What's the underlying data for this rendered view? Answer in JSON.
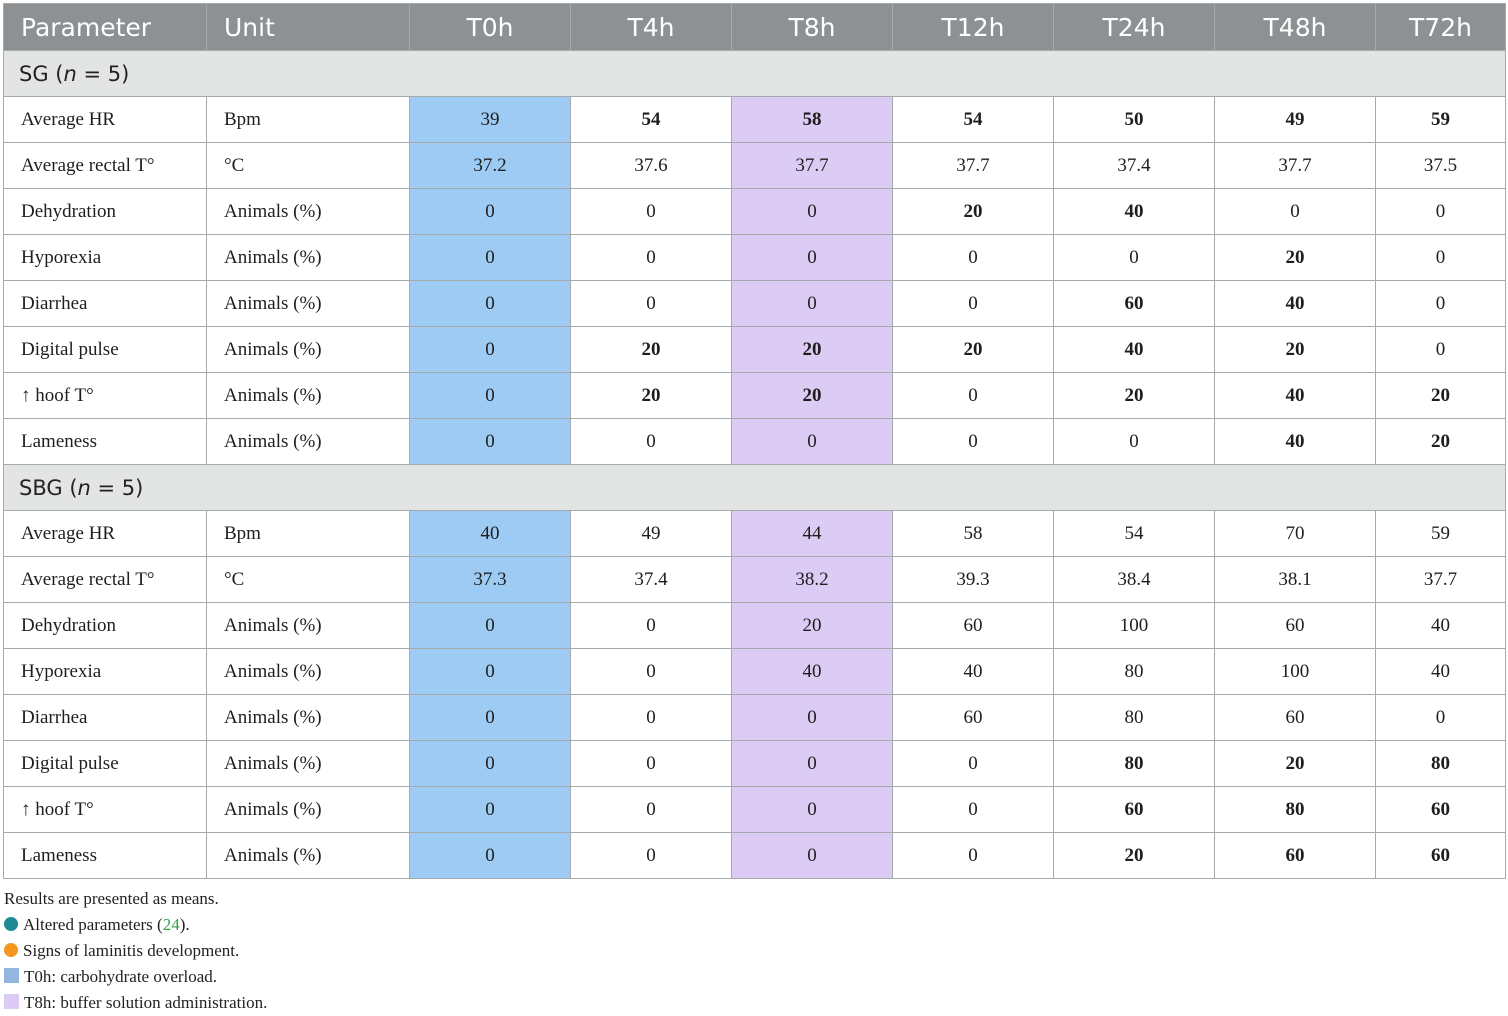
{
  "headers": [
    "Parameter",
    "Unit",
    "T0h",
    "T4h",
    "T8h",
    "T12h",
    "T24h",
    "T48h",
    "T72h"
  ],
  "groups": [
    {
      "label_prefix": "SG (",
      "label_n": "n",
      "label_suffix": " = 5)",
      "rows": [
        {
          "param": "Average HR",
          "unit": "Bpm",
          "values": [
            "39",
            "54",
            "58",
            "54",
            "50",
            "49",
            "59"
          ],
          "styles": [
            "n",
            "bt",
            "bt",
            "bt",
            "bt",
            "bt",
            "bt"
          ]
        },
        {
          "param": "Average rectal T°",
          "unit": "°C",
          "values": [
            "37.2",
            "37.6",
            "37.7",
            "37.7",
            "37.4",
            "37.7",
            "37.5"
          ],
          "styles": [
            "n",
            "n",
            "n",
            "n",
            "n",
            "n",
            "n"
          ]
        },
        {
          "param": "Dehydration",
          "unit": "Animals (%)",
          "values": [
            "0",
            "0",
            "0",
            "20",
            "40",
            "0",
            "0"
          ],
          "styles": [
            "n",
            "n",
            "n",
            "bt",
            "bt",
            "n",
            "n"
          ]
        },
        {
          "param": "Hyporexia",
          "unit": "Animals (%)",
          "values": [
            "0",
            "0",
            "0",
            "0",
            "0",
            "20",
            "0"
          ],
          "styles": [
            "n",
            "n",
            "n",
            "n",
            "n",
            "bt",
            "n"
          ]
        },
        {
          "param": "Diarrhea",
          "unit": "Animals (%)",
          "values": [
            "0",
            "0",
            "0",
            "0",
            "60",
            "40",
            "0"
          ],
          "styles": [
            "n",
            "n",
            "n",
            "n",
            "bt",
            "bt",
            "n"
          ]
        },
        {
          "param": "Digital pulse",
          "unit": "Animals (%)",
          "values": [
            "0",
            "20",
            "20",
            "20",
            "40",
            "20",
            "0"
          ],
          "styles": [
            "n",
            "o",
            "o",
            "o",
            "o",
            "o",
            "n"
          ]
        },
        {
          "param": "↑ hoof T°",
          "unit": "Animals (%)",
          "values": [
            "0",
            "20",
            "20",
            "0",
            "20",
            "40",
            "20"
          ],
          "styles": [
            "n",
            "o",
            "o",
            "n",
            "o",
            "o",
            "o"
          ]
        },
        {
          "param": "Lameness",
          "unit": "Animals (%)",
          "values": [
            "0",
            "0",
            "0",
            "0",
            "0",
            "40",
            "20"
          ],
          "styles": [
            "n",
            "n",
            "n",
            "n",
            "n",
            "o",
            "o"
          ]
        }
      ]
    },
    {
      "label_prefix": "SBG (",
      "label_n": "n",
      "label_suffix": " = 5)",
      "rows": [
        {
          "param": "Average HR",
          "unit": "Bpm",
          "values": [
            "40",
            "49",
            "44",
            "58",
            "54",
            "70",
            "59"
          ],
          "styles": [
            "n",
            "t",
            "t",
            "t",
            "t",
            "t",
            "t"
          ]
        },
        {
          "param": "Average rectal T°",
          "unit": "°C",
          "values": [
            "37.3",
            "37.4",
            "38.2",
            "39.3",
            "38.4",
            "38.1",
            "37.7"
          ],
          "styles": [
            "n",
            "n",
            "n",
            "t",
            "n",
            "n",
            "n"
          ]
        },
        {
          "param": "Dehydration",
          "unit": "Animals (%)",
          "values": [
            "0",
            "0",
            "20",
            "60",
            "100",
            "60",
            "40"
          ],
          "styles": [
            "n",
            "n",
            "t",
            "t",
            "t",
            "t",
            "t"
          ]
        },
        {
          "param": "Hyporexia",
          "unit": "Animals (%)",
          "values": [
            "0",
            "0",
            "40",
            "40",
            "80",
            "100",
            "40"
          ],
          "styles": [
            "n",
            "n",
            "t",
            "t",
            "t",
            "t",
            "t"
          ]
        },
        {
          "param": "Diarrhea",
          "unit": "Animals (%)",
          "values": [
            "0",
            "0",
            "0",
            "60",
            "80",
            "60",
            "0"
          ],
          "styles": [
            "n",
            "n",
            "n",
            "t",
            "t",
            "t",
            "n"
          ]
        },
        {
          "param": "Digital pulse",
          "unit": "Animals (%)",
          "values": [
            "0",
            "0",
            "0",
            "0",
            "80",
            "20",
            "80"
          ],
          "styles": [
            "n",
            "n",
            "n",
            "n",
            "o",
            "o",
            "o"
          ]
        },
        {
          "param": "↑ hoof T°",
          "unit": "Animals (%)",
          "values": [
            "0",
            "0",
            "0",
            "0",
            "60",
            "80",
            "60"
          ],
          "styles": [
            "n",
            "n",
            "n",
            "n",
            "o",
            "o",
            "o"
          ]
        },
        {
          "param": "Lameness",
          "unit": "Animals (%)",
          "values": [
            "0",
            "0",
            "0",
            "0",
            "20",
            "60",
            "60"
          ],
          "styles": [
            "n",
            "n",
            "n",
            "n",
            "o",
            "o",
            "o"
          ]
        }
      ]
    }
  ],
  "notes": {
    "means": "Results are presented as means.",
    "altered_prefix": "Altered parameters (",
    "altered_ref": "24",
    "altered_suffix": ").",
    "laminitis": "Signs of laminitis development.",
    "t0h": "T0h: carbohydrate overload.",
    "t8h": "T8h: buffer solution administration."
  },
  "colors": {
    "altered": "#1f8a96",
    "laminitis": "#f5961e",
    "t0h_highlight": "#9ecbf3",
    "t8h_highlight": "#dccbf5",
    "header_bg": "#8d9193",
    "group_bg": "#e3e5e4"
  }
}
